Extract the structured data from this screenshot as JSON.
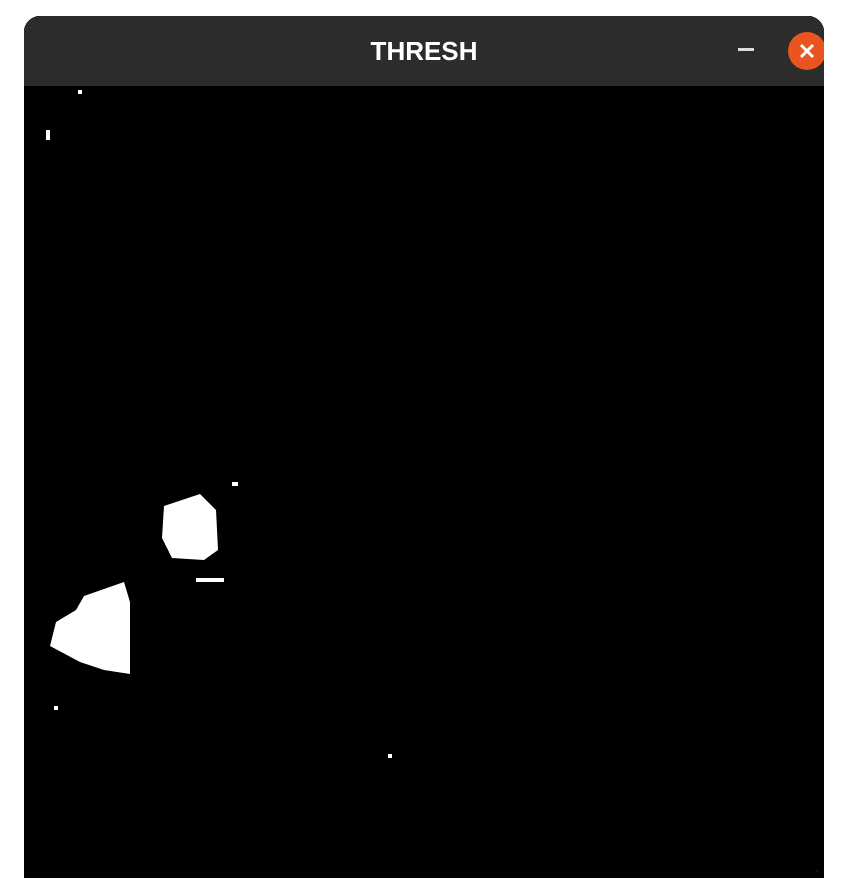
{
  "window": {
    "title": "THRESH"
  }
}
